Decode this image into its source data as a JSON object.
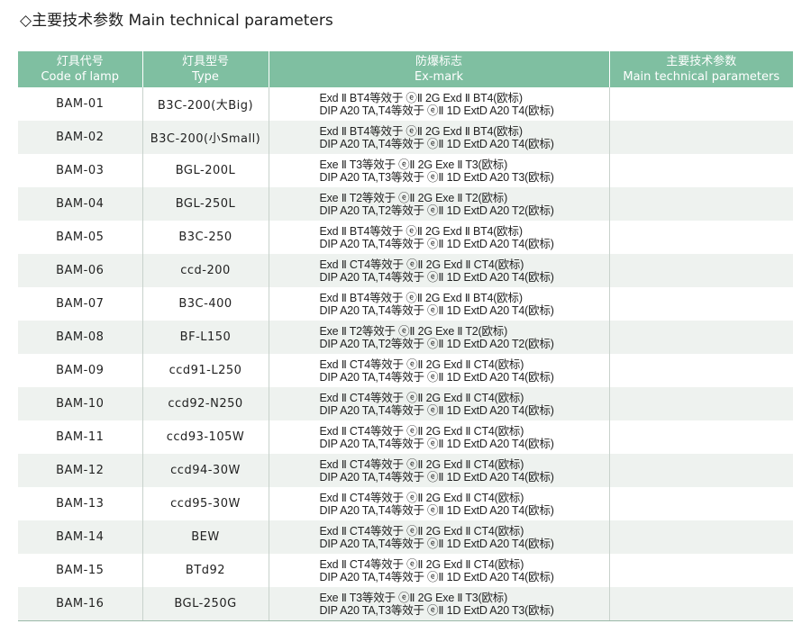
{
  "title": "◇主要技术参数 Main technical parameters",
  "header": {
    "code": {
      "cn": "灯具代号",
      "en": "Code of lamp"
    },
    "type": {
      "cn": "灯具型号",
      "en": "Type"
    },
    "mark": {
      "cn": "防爆标志",
      "en": "Ex-mark"
    },
    "params": {
      "cn": "主要技术参数",
      "en": "Main technical parameters"
    }
  },
  "rows": [
    {
      "code": "BAM-01",
      "type": "B3C-200(大Big)",
      "mark1": "Exd Ⅱ BT4等效于 ⓔⅡ 2G Exd Ⅱ BT4(欧标)",
      "mark2": "DIP A20 TA,T4等效于 ⓔⅡ 1D ExtD A20 T4(欧标)",
      "params": ""
    },
    {
      "code": "BAM-02",
      "type": "B3C-200(小Small)",
      "mark1": "Exd Ⅱ BT4等效于 ⓔⅡ 2G Exd Ⅱ BT4(欧标)",
      "mark2": "DIP A20 TA,T4等效于 ⓔⅡ 1D ExtD A20 T4(欧标)",
      "params": ""
    },
    {
      "code": "BAM-03",
      "type": "BGL-200L",
      "mark1": "Exe Ⅱ T3等效于 ⓔⅡ 2G Exe Ⅱ T3(欧标)",
      "mark2": "DIP A20 TA,T3等效于 ⓔⅡ 1D ExtD A20 T3(欧标)",
      "params": ""
    },
    {
      "code": "BAM-04",
      "type": "BGL-250L",
      "mark1": "Exe Ⅱ T2等效于 ⓔⅡ 2G Exe Ⅱ T2(欧标)",
      "mark2": "DIP A20 TA,T2等效于 ⓔⅡ 1D ExtD A20 T2(欧标)",
      "params": ""
    },
    {
      "code": "BAM-05",
      "type": "B3C-250",
      "mark1": "Exd Ⅱ BT4等效于 ⓔⅡ 2G Exd Ⅱ BT4(欧标)",
      "mark2": "DIP A20 TA,T4等效于 ⓔⅡ 1D ExtD A20 T4(欧标)",
      "params": ""
    },
    {
      "code": "BAM-06",
      "type": "ccd-200",
      "mark1": "Exd Ⅱ CT4等效于 ⓔⅡ 2G Exd Ⅱ CT4(欧标)",
      "mark2": "DIP A20 TA,T4等效于 ⓔⅡ 1D ExtD A20 T4(欧标)",
      "params": ""
    },
    {
      "code": "BAM-07",
      "type": "B3C-400",
      "mark1": "Exd Ⅱ BT4等效于 ⓔⅡ 2G Exd Ⅱ BT4(欧标)",
      "mark2": "DIP A20 TA,T4等效于 ⓔⅡ 1D ExtD A20 T4(欧标)",
      "params": ""
    },
    {
      "code": "BAM-08",
      "type": "BF-L150",
      "mark1": "Exe Ⅱ T2等效于 ⓔⅡ 2G Exe Ⅱ T2(欧标)",
      "mark2": "DIP A20 TA,T2等效于 ⓔⅡ 1D ExtD A20 T2(欧标)",
      "params": ""
    },
    {
      "code": "BAM-09",
      "type": "ccd91-L250",
      "mark1": "Exd Ⅱ CT4等效于 ⓔⅡ 2G Exd Ⅱ CT4(欧标)",
      "mark2": "DIP A20 TA,T4等效于 ⓔⅡ 1D ExtD A20 T4(欧标)",
      "params": ""
    },
    {
      "code": "BAM-10",
      "type": "ccd92-N250",
      "mark1": "Exd Ⅱ CT4等效于 ⓔⅡ 2G Exd Ⅱ CT4(欧标)",
      "mark2": "DIP A20 TA,T4等效于 ⓔⅡ 1D ExtD A20 T4(欧标)",
      "params": ""
    },
    {
      "code": "BAM-11",
      "type": "ccd93-105W",
      "mark1": "Exd Ⅱ CT4等效于 ⓔⅡ 2G Exd Ⅱ CT4(欧标)",
      "mark2": "DIP A20 TA,T4等效于 ⓔⅡ 1D ExtD A20 T4(欧标)",
      "params": ""
    },
    {
      "code": "BAM-12",
      "type": "ccd94-30W",
      "mark1": "Exd Ⅱ CT4等效于 ⓔⅡ 2G Exd Ⅱ CT4(欧标)",
      "mark2": "DIP A20 TA,T4等效于 ⓔⅡ 1D ExtD A20 T4(欧标)",
      "params": ""
    },
    {
      "code": "BAM-13",
      "type": "ccd95-30W",
      "mark1": "Exd Ⅱ CT4等效于 ⓔⅡ 2G Exd Ⅱ CT4(欧标)",
      "mark2": "DIP A20 TA,T4等效于 ⓔⅡ 1D ExtD A20 T4(欧标)",
      "params": ""
    },
    {
      "code": "BAM-14",
      "type": "BEW",
      "mark1": "Exd Ⅱ CT4等效于 ⓔⅡ 2G Exd Ⅱ CT4(欧标)",
      "mark2": "DIP A20 TA,T4等效于 ⓔⅡ 1D ExtD A20 T4(欧标)",
      "params": ""
    },
    {
      "code": "BAM-15",
      "type": "BTd92",
      "mark1": "Exd Ⅱ CT4等效于 ⓔⅡ 2G Exd Ⅱ CT4(欧标)",
      "mark2": "DIP A20 TA,T4等效于 ⓔⅡ 1D ExtD A20 T4(欧标)",
      "params": ""
    },
    {
      "code": "BAM-16",
      "type": "BGL-250G",
      "mark1": "Exe Ⅱ T3等效于 ⓔⅡ 2G Exe Ⅱ T3(欧标)",
      "mark2": "DIP A20 TA,T3等效于 ⓔⅡ 1D ExtD A20 T3(欧标)",
      "params": ""
    }
  ]
}
